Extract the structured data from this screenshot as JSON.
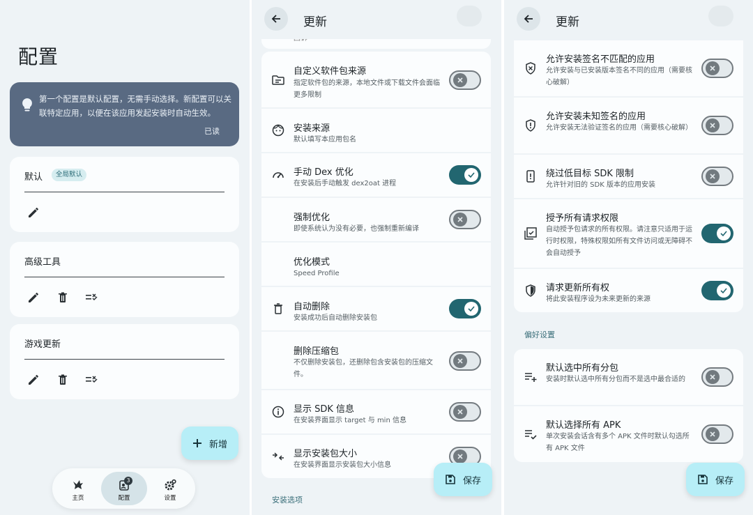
{
  "screen1": {
    "title": "配置",
    "tip": {
      "text": "第一个配置是默认配置，无需手动选择。新配置可以关联特定应用，以便在该应用发起安装时自动生效。",
      "action": "已读"
    },
    "profiles": [
      {
        "name": "默认",
        "badge": "全局默认"
      },
      {
        "name": "高级工具"
      },
      {
        "name": "游戏更新"
      }
    ],
    "fab_label": "新增",
    "nav": [
      {
        "label": "主页",
        "icon": "bird-icon"
      },
      {
        "label": "配置",
        "icon": "profile-icon",
        "badge": "3"
      },
      {
        "label": "设置",
        "icon": "gear-icon"
      }
    ]
  },
  "screen2": {
    "title": "更新",
    "cut_text": "回诉",
    "rows": [
      {
        "title": "自定义软件包来源",
        "desc": "指定软件包的来源，本地文件或下载文件会面临更多限制",
        "icon": "folder-list-icon",
        "on": false
      },
      {
        "title": "安装来源",
        "desc": "默认填写本应用包名",
        "icon": "face-icon",
        "on": null
      },
      {
        "title": "手动 Dex 优化",
        "desc": "在安装后手动触发 dex2oat 进程",
        "icon": "speedometer-icon",
        "on": true
      },
      {
        "title": "强制优化",
        "desc": "即使系统认为没有必要，也强制重新编译",
        "icon": "",
        "on": false
      },
      {
        "title": "优化模式",
        "desc": "Speed Profile",
        "icon": "",
        "on": null
      },
      {
        "title": "自动删除",
        "desc": "安装成功后自动删除安装包",
        "icon": "trash-icon",
        "on": true
      },
      {
        "title": "删除压缩包",
        "desc": "不仅删除安装包，还删除包含安装包的压缩文件。",
        "icon": "",
        "on": false
      },
      {
        "title": "显示 SDK 信息",
        "desc": "在安装界面显示 target 与 min 信息",
        "icon": "info-icon",
        "on": false
      },
      {
        "title": "显示安装包大小",
        "desc": "在安装界面显示安装包大小信息",
        "icon": "compress-icon",
        "on": false
      }
    ],
    "section": "安装选项",
    "save_label": "保存"
  },
  "screen3": {
    "title": "更新",
    "rows": [
      {
        "title": "允许安装签名不匹配的应用",
        "desc": "允许安装与已安装版本签名不同的应用（需要核心破解）",
        "icon": "shield-x-icon",
        "on": false
      },
      {
        "title": "允许安装未知签名的应用",
        "desc": "允许安装无法验证签名的应用（需要核心破解）",
        "icon": "shield-alert-icon",
        "on": false
      },
      {
        "title": "绕过低目标 SDK 限制",
        "desc": "允许针对旧的 SDK 版本的应用安装",
        "icon": "phone-alert-icon",
        "on": false
      },
      {
        "title": "授予所有请求权限",
        "desc": "自动授予包请求的所有权限。请注意只适用于运行时权限，特殊权限如所有文件访问或无障碍不会自动授予",
        "icon": "checklist-icon",
        "on": true
      },
      {
        "title": "请求更新所有权",
        "desc": "将此安装程序设为未来更新的来源",
        "icon": "shield-check-icon",
        "on": true
      }
    ],
    "section": "偏好设置",
    "pref_rows": [
      {
        "title": "默认选中所有分包",
        "desc": "安装时默认选中所有分包而不是选中最合适的",
        "icon": "playlist-add-icon",
        "on": false
      },
      {
        "title": "默认选择所有 APK",
        "desc": "单次安装会话含有多个 APK 文件时默认勾选所有 APK 文件",
        "icon": "playlist-check-icon",
        "on": false
      }
    ],
    "save_label": "保存"
  }
}
